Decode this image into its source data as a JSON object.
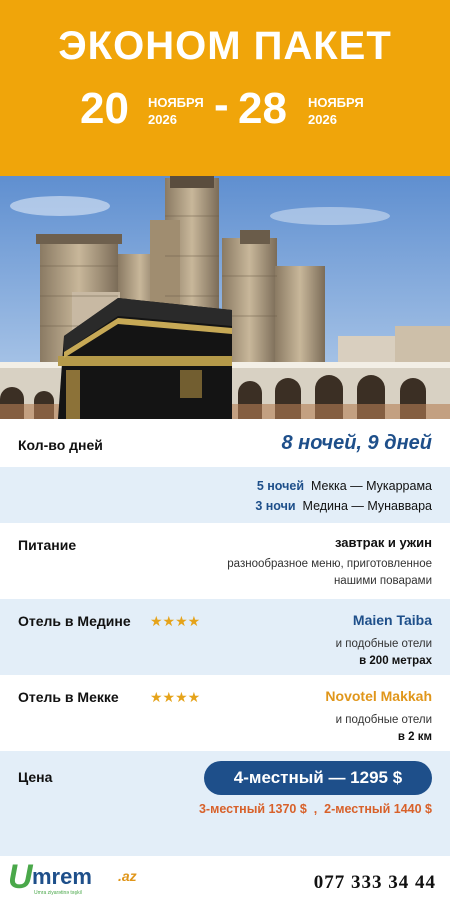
{
  "header": {
    "title": "ЭКОНОМ ПАКЕТ",
    "start": {
      "day": "20",
      "month": "НОЯБРЯ",
      "year": "2026"
    },
    "separator": "-",
    "end": {
      "day": "28",
      "month": "НОЯБРЯ",
      "year": "2026"
    }
  },
  "days": {
    "label": "Кол-во дней",
    "value": "8 ночей, 9 дней",
    "lines": [
      {
        "nights": "5 ночей",
        "route": "Мекка — Мукаррама"
      },
      {
        "nights": "3 ночи",
        "route": "Медина — Мунаввара"
      }
    ]
  },
  "food": {
    "label": "Питание",
    "value": "завтрак и ужин",
    "note_1": "разнообразное меню, приготовленное",
    "note_2": "нашими поварами"
  },
  "hotel_medina": {
    "label": "Отель в Медине",
    "stars": "★★★★",
    "name": "Maien Taiba",
    "note": "и подобные отели",
    "distance": "в 200 метрах"
  },
  "hotel_mecca": {
    "label": "Отель в Мекке",
    "stars": "★★★★",
    "name": "Novotel Makkah",
    "note": "и подобные отели",
    "distance": "в 2 км"
  },
  "price": {
    "label": "Цена",
    "main": "4-местный — 1295 $",
    "other": "3-местный 1370 $  ,  2-местный 1440 $"
  },
  "footer": {
    "logo_text": "mrem",
    "logo_letter": "U",
    "logo_suffix": ".az",
    "logo_tagline": "Umra ziyarətinə təşkil",
    "phone": "077 333 34 44"
  },
  "colors": {
    "accent": "#f0a50a",
    "brand_blue": "#1e4f8a",
    "price_orange": "#d8612a"
  }
}
